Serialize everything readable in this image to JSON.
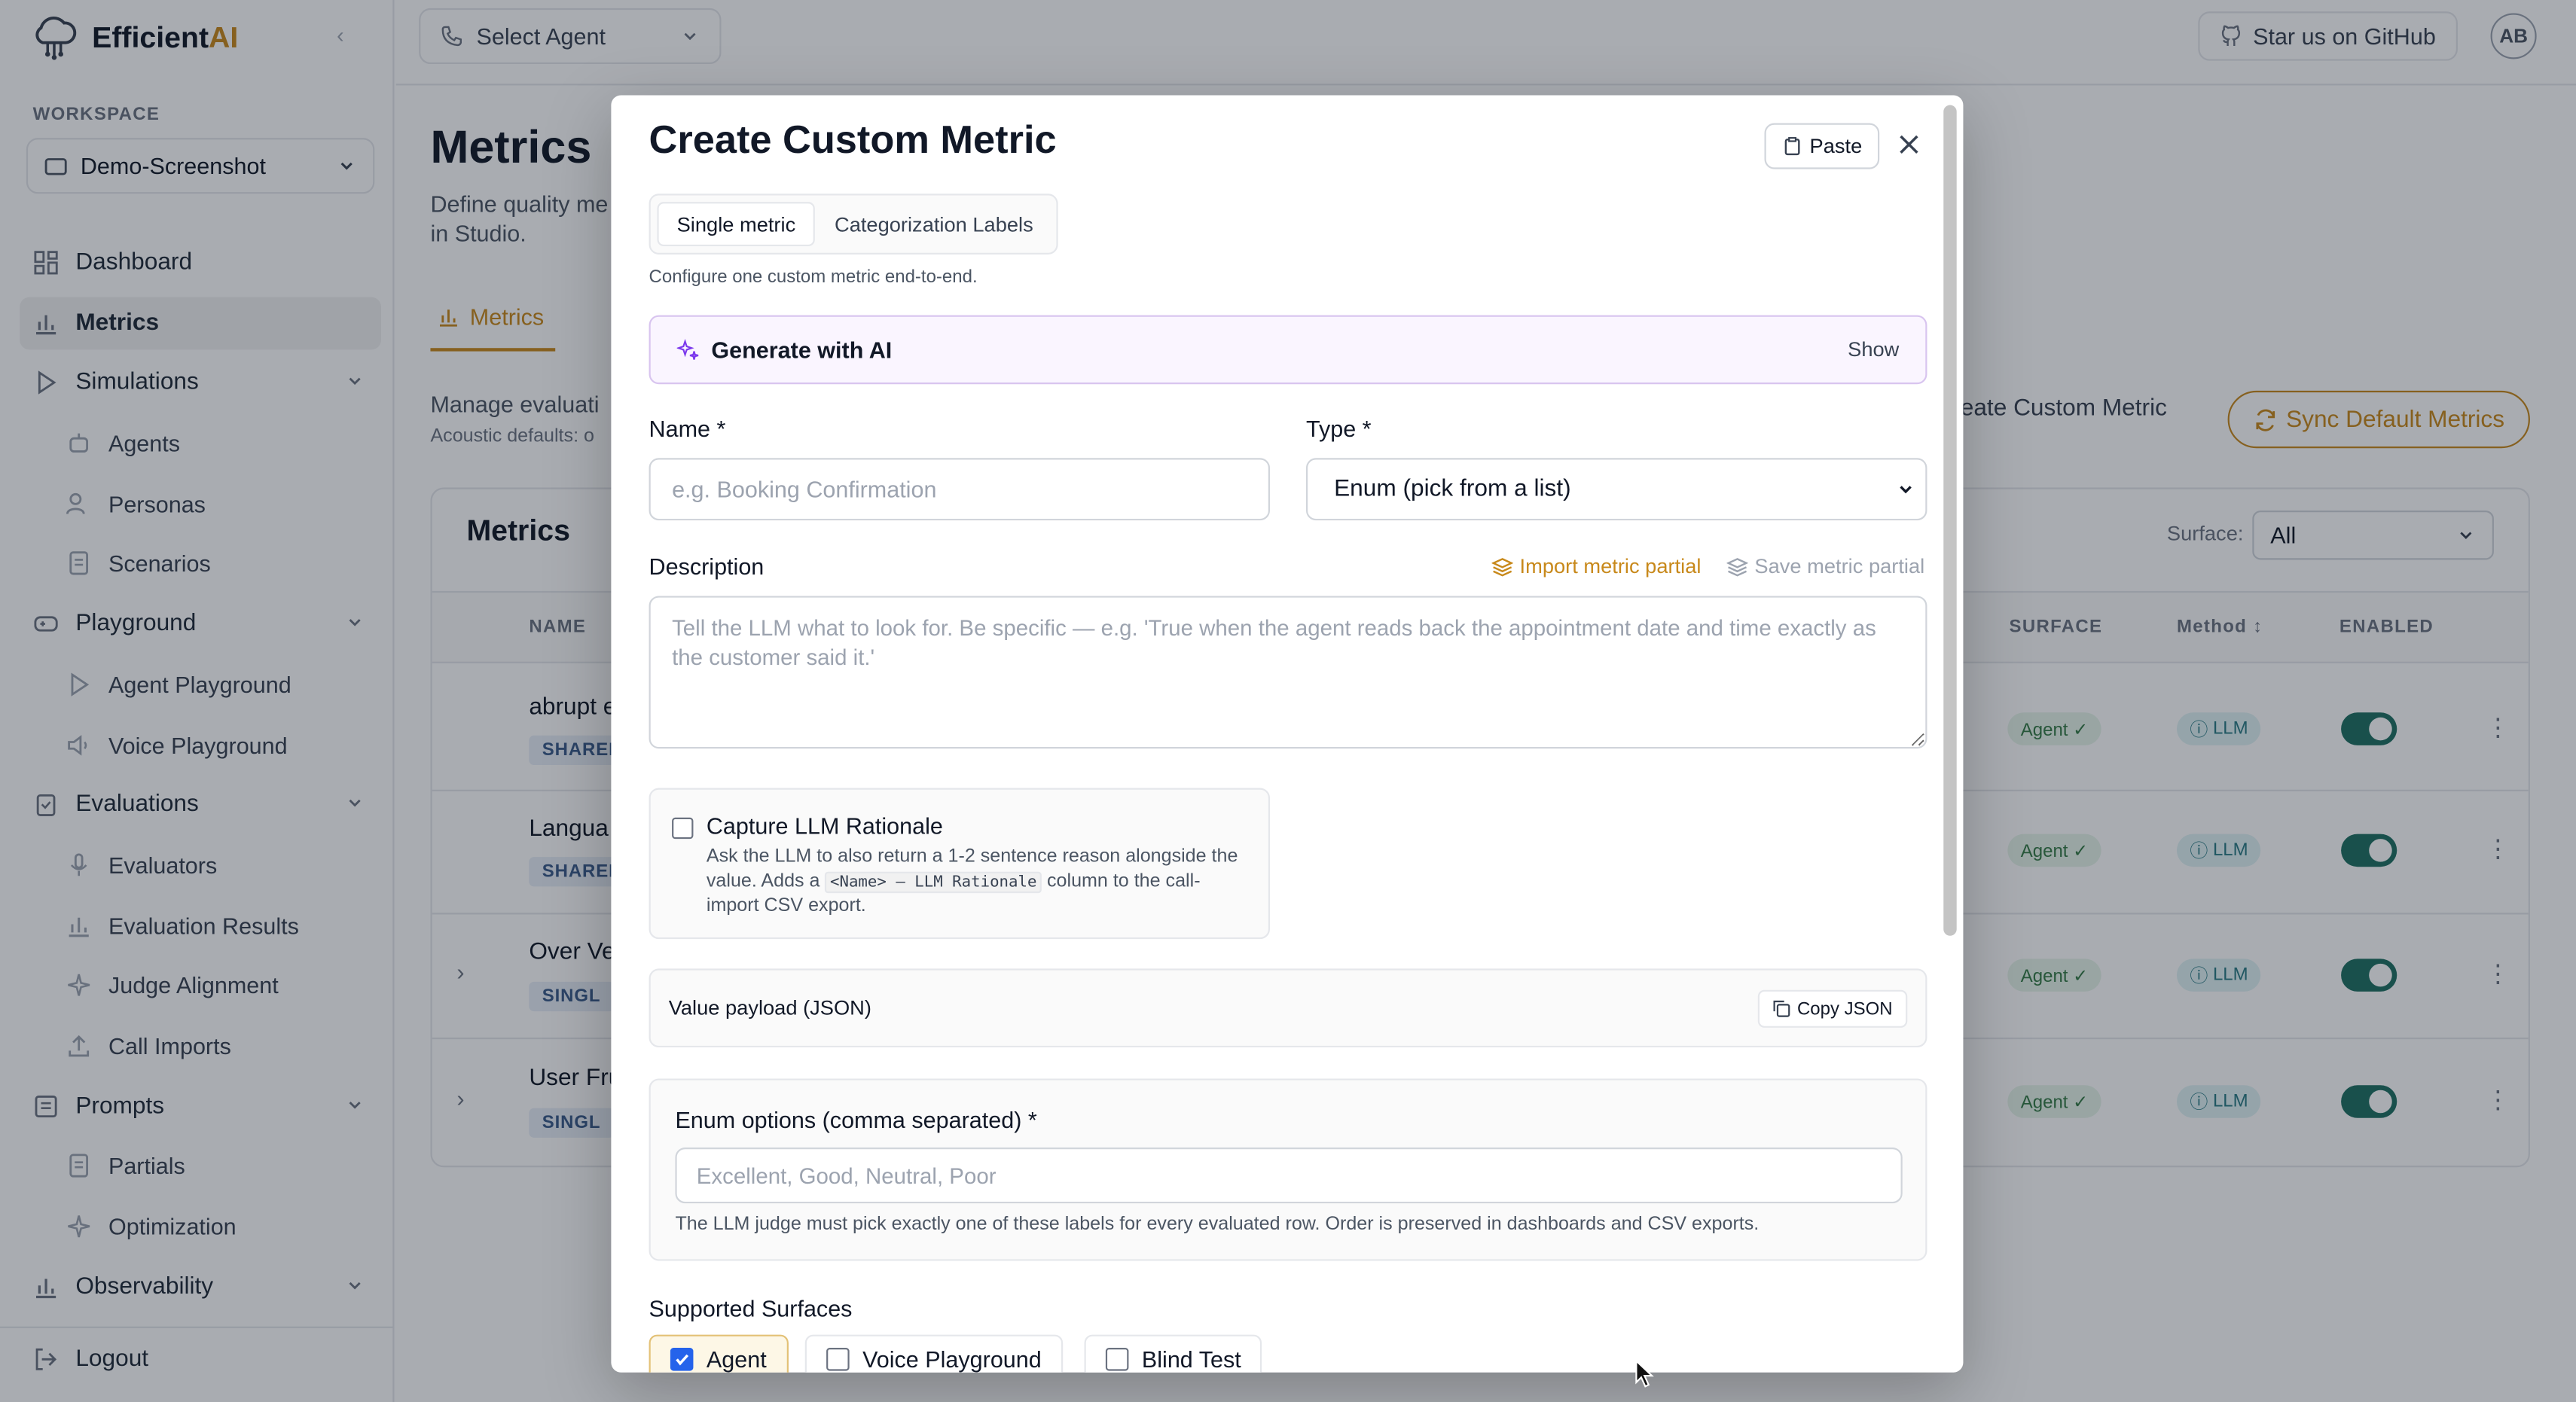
{
  "app": {
    "brand_first": "Efficient",
    "brand_second": "AI",
    "accent_color": "#c8891b",
    "collapse_icon": "chevron-left-icon"
  },
  "sidebar": {
    "workspace_label": "WORKSPACE",
    "workspace_value": "Demo-Screenshot",
    "items": [
      {
        "label": "Dashboard",
        "icon": "dashboard-icon"
      },
      {
        "label": "Metrics",
        "icon": "bar-chart-icon",
        "active": true
      },
      {
        "label": "Simulations",
        "icon": "play-icon"
      },
      {
        "label": "Agents",
        "icon": "robot-icon"
      },
      {
        "label": "Personas",
        "icon": "users-icon"
      },
      {
        "label": "Scenarios",
        "icon": "document-icon"
      },
      {
        "label": "Playground",
        "icon": "gamepad-icon"
      },
      {
        "label": "Agent Playground",
        "icon": "play-icon"
      },
      {
        "label": "Voice Playground",
        "icon": "speaker-icon"
      },
      {
        "label": "Evaluations",
        "icon": "clipboard-icon"
      },
      {
        "label": "Evaluators",
        "icon": "microphone-icon"
      },
      {
        "label": "Evaluation Results",
        "icon": "bar-chart-icon"
      },
      {
        "label": "Judge Alignment",
        "icon": "sparkle-icon"
      },
      {
        "label": "Call Imports",
        "icon": "upload-icon"
      },
      {
        "label": "Prompts",
        "icon": "list-icon"
      },
      {
        "label": "Partials",
        "icon": "document-icon"
      },
      {
        "label": "Optimization",
        "icon": "sparkle-icon"
      },
      {
        "label": "Observability",
        "icon": "bar-chart-icon"
      }
    ],
    "logout": "Logout"
  },
  "topbar": {
    "agent_select": "Select Agent",
    "github": "Star us on GitHub",
    "avatar": "AB"
  },
  "page": {
    "title": "Metrics",
    "desc": "Define quality me… in Studio.",
    "desc_line1": "Define quality me",
    "desc_line2": "in Studio.",
    "tab": "Metrics",
    "manage": "Manage evaluati",
    "acoustic": "Acoustic defaults: o",
    "create_btn": "Create Custom Metric",
    "sync_btn": "Sync Default Metrics",
    "card_title": "Metrics",
    "surface_label": "Surface:",
    "surface_value": "All",
    "columns": {
      "name": "NAME",
      "surface": "SURFACE",
      "method": "Method ↕",
      "enabled": "ENABLED"
    },
    "rows": [
      {
        "name": "abrupt e",
        "tag": "SHARED",
        "surface": "Agent ✓",
        "method": "LLM"
      },
      {
        "name": "Langua",
        "tag": "SHARED",
        "surface": "Agent ✓",
        "method": "LLM"
      },
      {
        "name": "Over Ve",
        "tag": "SINGL",
        "surface": "Agent ✓",
        "method": "LLM"
      },
      {
        "name": "User Fru",
        "tag": "SINGL",
        "surface": "Agent ✓",
        "method": "LLM"
      }
    ]
  },
  "modal": {
    "title": "Create Custom Metric",
    "paste": "Paste",
    "seg_single": "Single metric",
    "seg_labels": "Categorization Labels",
    "seg_desc": "Configure one custom metric end-to-end.",
    "generate": "Generate with AI",
    "show": "Show",
    "name_label": "Name *",
    "name_placeholder": "e.g. Booking Confirmation",
    "type_label": "Type *",
    "type_value": "Enum (pick from a list)",
    "desc_label": "Description",
    "import_partial": "Import metric partial",
    "save_partial": "Save metric partial",
    "desc_placeholder": "Tell the LLM what to look for. Be specific — e.g. 'True when the agent reads back the appointment date and time exactly as the customer said it.'",
    "capture_title": "Capture LLM Rationale",
    "capture_text_a": "Ask the LLM to also return a 1-2 sentence reason alongside the value. Adds a ",
    "capture_code": "<Name> — LLM Rationale",
    "capture_text_b": " column to the call-import CSV export.",
    "payload_label": "Value payload (JSON)",
    "copy_json": "Copy JSON",
    "enum_label": "Enum options (comma separated) *",
    "enum_placeholder": "Excellent, Good, Neutral, Poor",
    "enum_help": "The LLM judge must pick exactly one of these labels for every evaluated row. Order is preserved in dashboards and CSV exports.",
    "surfaces_label": "Supported Surfaces",
    "surfaces": [
      {
        "label": "Agent",
        "checked": true
      },
      {
        "label": "Voice Playground",
        "checked": false
      },
      {
        "label": "Blind Test",
        "checked": false
      }
    ]
  }
}
